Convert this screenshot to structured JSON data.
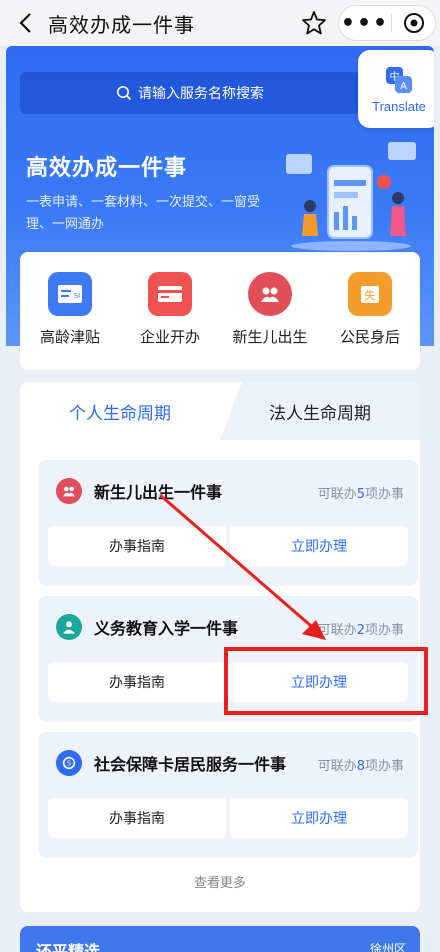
{
  "nav": {
    "title": "高效办成一件事",
    "more": "•••"
  },
  "search": {
    "placeholder": "请输入服务名称搜索"
  },
  "translate": {
    "label": "Translate"
  },
  "hero": {
    "title": "高效办成一件事",
    "subtitle": "一表申请、一套材料、一次提交、一窗受理、一网通办"
  },
  "quick": [
    {
      "label": "高龄津贴",
      "icon": "allowance-card-icon",
      "color": "#3d7bf4"
    },
    {
      "label": "企业开办",
      "icon": "business-card-icon",
      "color": "#ef5350"
    },
    {
      "label": "新生儿出生",
      "icon": "newborn-icon",
      "color": "#e24d5a"
    },
    {
      "label": "公民身后",
      "icon": "citizen-afterlife-icon",
      "color": "#f39c2b"
    }
  ],
  "tabs": {
    "active": "个人生命周期",
    "other": "法人生命周期"
  },
  "services": [
    {
      "title": "新生儿出生一件事",
      "count_prefix": "可联办",
      "count": "5",
      "count_suffix": "项办事",
      "guide": "办事指南",
      "go": "立即办理",
      "icon": "newborn-icon"
    },
    {
      "title": "义务教育入学一件事",
      "count_prefix": "可联办",
      "count": "2",
      "count_suffix": "项办事",
      "guide": "办事指南",
      "go": "立即办理",
      "icon": "student-icon"
    },
    {
      "title": "社会保障卡居民服务一件事",
      "count_prefix": "可联办",
      "count": "8",
      "count_suffix": "项办事",
      "guide": "办事指南",
      "go": "立即办理",
      "icon": "social-security-icon"
    }
  ],
  "more": "查看更多",
  "bottom": {
    "left": "还平精选",
    "right": "徐州区"
  },
  "colors": {
    "primary": "#2f6cf3",
    "annotation": "#e8201c"
  }
}
